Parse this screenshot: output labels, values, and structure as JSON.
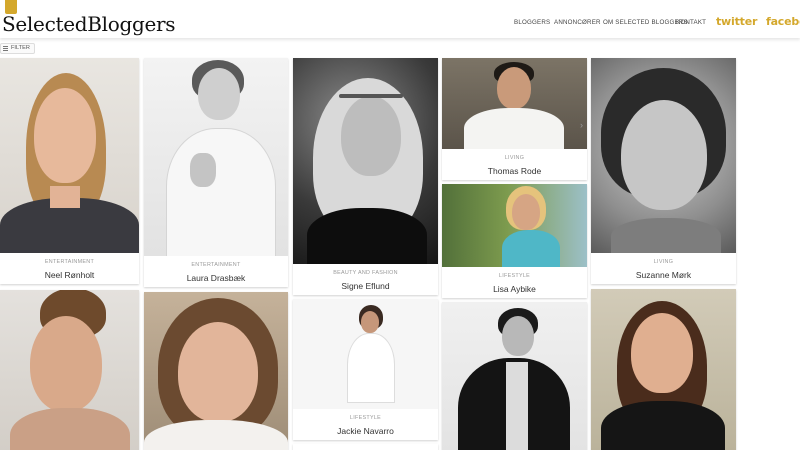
{
  "header": {
    "logo": "SelectedBloggers",
    "nav": [
      "BLOGGERS",
      "ANNONCØRER",
      "OM SELECTED BLOGGERS",
      "KONTAKT"
    ],
    "twitter": "twitter",
    "facebook": "facebook"
  },
  "filter": {
    "label": "FILTER"
  },
  "bloggers": [
    {
      "category": "ENTERTAINMENT",
      "name": "Neel Rønholt"
    },
    {
      "category": "ENTERTAINMENT",
      "name": "Laura Drasbæk"
    },
    {
      "category": "BEAUTY AND FASHION",
      "name": "Signe Eflund"
    },
    {
      "category": "LIVING",
      "name": "Thomas Rode"
    },
    {
      "category": "LIVING",
      "name": "Suzanne Mørk"
    },
    {
      "category": "LIFESTYLE",
      "name": "Lisa Aybike"
    },
    {
      "category": "LIFESTYLE",
      "name": "Jackie Navarro"
    }
  ]
}
